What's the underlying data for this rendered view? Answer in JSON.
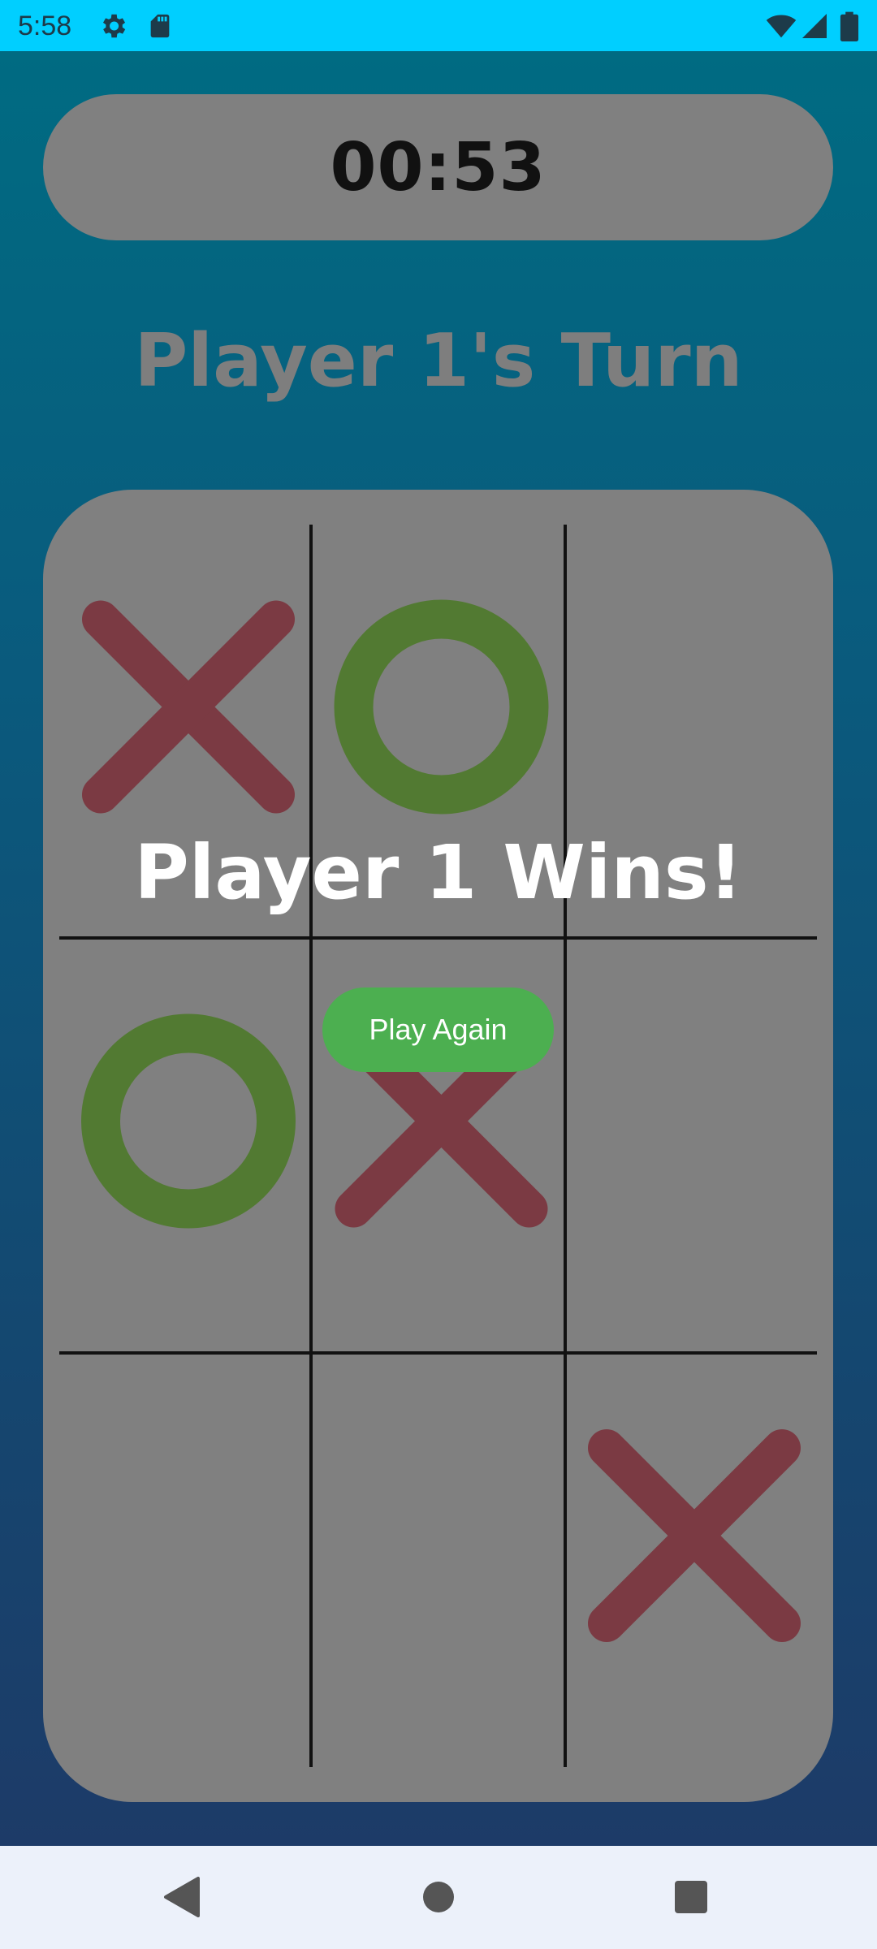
{
  "status_bar": {
    "time": "5:58",
    "icons": [
      "settings-icon",
      "sd-card-icon",
      "wifi-icon",
      "cell-signal-icon",
      "battery-icon"
    ]
  },
  "game": {
    "timer": "00:53",
    "turn_label": "Player 1's Turn",
    "result_label": "Player 1 Wins!",
    "play_again_label": "Play Again",
    "board": [
      [
        "X",
        "O",
        ""
      ],
      [
        "O",
        "X",
        ""
      ],
      [
        "",
        "",
        "X"
      ]
    ]
  },
  "colors": {
    "x_mark": "#7b3a43",
    "o_mark": "#527a32",
    "board": "#808080",
    "grid_line": "#111111",
    "play_again_button": "#4caf50",
    "status_bar": "#00cfff"
  },
  "nav_bar": {
    "icons": [
      "back-icon",
      "home-icon",
      "recents-icon"
    ]
  }
}
